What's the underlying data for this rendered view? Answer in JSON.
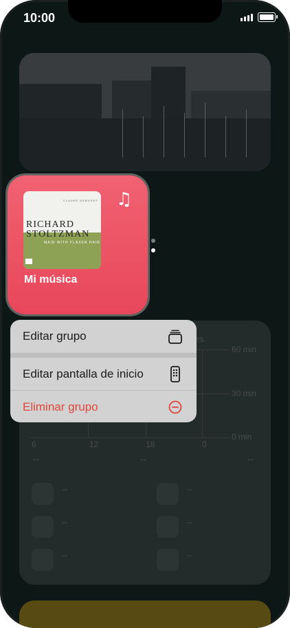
{
  "status_bar": {
    "time": "10:00"
  },
  "music_widget": {
    "label": "Mi música",
    "album": {
      "composer": "CLAUDE DEBUSSY",
      "artist_line1": "RICHARD",
      "artist_line2": "STOLTZMAN",
      "title": "MAID WITH FLAXEN HAIR"
    }
  },
  "background_widget": {
    "partial_text": "es.",
    "y_labels": [
      "60 min",
      "30 min",
      "0 min"
    ],
    "x_labels": [
      "6",
      "12",
      "18",
      "0"
    ],
    "dash": "--"
  },
  "context_menu": {
    "items": [
      {
        "label": "Editar grupo",
        "icon": "stack-icon"
      },
      {
        "label": "Editar pantalla de inicio",
        "icon": "phone-apps-icon"
      },
      {
        "label": "Eliminar grupo",
        "icon": "minus-circle-icon"
      }
    ]
  },
  "colors": {
    "music_widget": "#e8475a",
    "destructive": "#e0453a",
    "menu_bg": "#d2d2d2",
    "page_dot_active": "#ffffff",
    "page_dot_inactive": "#7a7f80"
  }
}
